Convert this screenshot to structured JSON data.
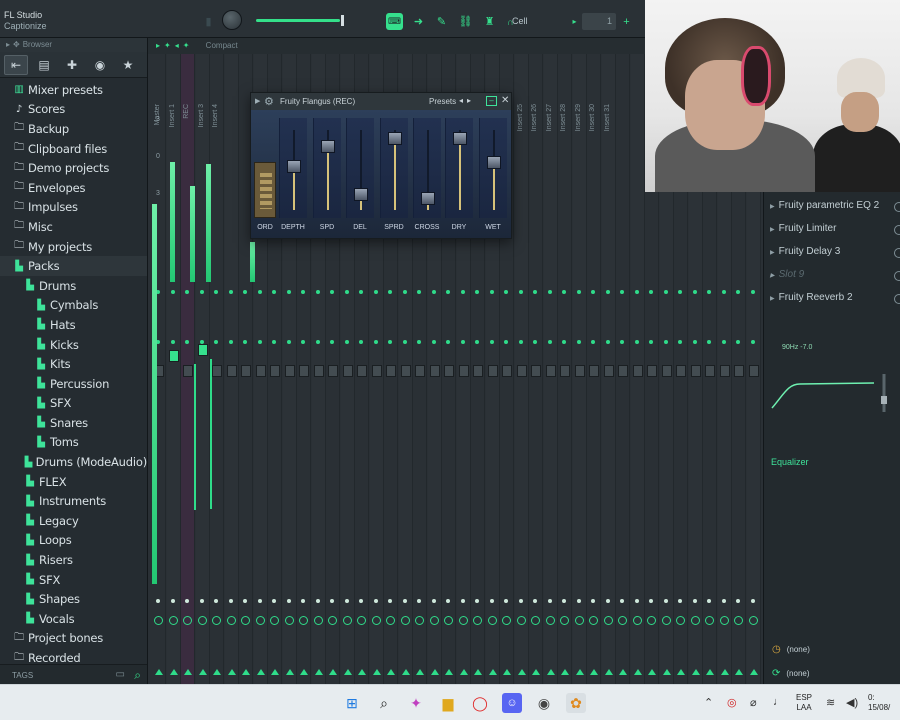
{
  "app": {
    "name": "FL Studio",
    "subtitle": "Captionize"
  },
  "toolbar": {
    "cell_label": "Cell",
    "pattern_value": "1"
  },
  "browser": {
    "header": "Browser",
    "footer_label": "TAGS",
    "items": [
      {
        "label": "Mixer presets",
        "level": 0,
        "icon": "mixer-preset-icon"
      },
      {
        "label": "Scores",
        "level": 0,
        "icon": "note-icon"
      },
      {
        "label": "Backup",
        "level": 0,
        "icon": "folder-icon"
      },
      {
        "label": "Clipboard files",
        "level": 0,
        "icon": "folder-icon"
      },
      {
        "label": "Demo projects",
        "level": 0,
        "icon": "folder-icon"
      },
      {
        "label": "Envelopes",
        "level": 0,
        "icon": "folder-icon"
      },
      {
        "label": "Impulses",
        "level": 0,
        "icon": "folder-icon"
      },
      {
        "label": "Misc",
        "level": 0,
        "icon": "folder-icon"
      },
      {
        "label": "My projects",
        "level": 0,
        "icon": "folder-icon"
      },
      {
        "label": "Packs",
        "level": 0,
        "icon": "pack-icon"
      },
      {
        "label": "Drums",
        "level": 1,
        "icon": "pack-icon"
      },
      {
        "label": "Cymbals",
        "level": 2,
        "icon": "pack-icon"
      },
      {
        "label": "Hats",
        "level": 2,
        "icon": "pack-icon"
      },
      {
        "label": "Kicks",
        "level": 2,
        "icon": "pack-icon"
      },
      {
        "label": "Kits",
        "level": 2,
        "icon": "pack-icon"
      },
      {
        "label": "Percussion",
        "level": 2,
        "icon": "pack-icon"
      },
      {
        "label": "SFX",
        "level": 2,
        "icon": "pack-icon"
      },
      {
        "label": "Snares",
        "level": 2,
        "icon": "pack-icon"
      },
      {
        "label": "Toms",
        "level": 2,
        "icon": "pack-icon"
      },
      {
        "label": "Drums (ModeAudio)",
        "level": 1,
        "icon": "pack-icon"
      },
      {
        "label": "FLEX",
        "level": 1,
        "icon": "pack-icon"
      },
      {
        "label": "Instruments",
        "level": 1,
        "icon": "pack-icon"
      },
      {
        "label": "Legacy",
        "level": 1,
        "icon": "pack-icon"
      },
      {
        "label": "Loops",
        "level": 1,
        "icon": "pack-icon"
      },
      {
        "label": "Risers",
        "level": 1,
        "icon": "pack-icon"
      },
      {
        "label": "SFX",
        "level": 1,
        "icon": "pack-icon"
      },
      {
        "label": "Shapes",
        "level": 1,
        "icon": "pack-icon"
      },
      {
        "label": "Vocals",
        "level": 1,
        "icon": "pack-icon"
      },
      {
        "label": "Project bones",
        "level": 0,
        "icon": "folder-icon"
      },
      {
        "label": "Recorded",
        "level": 0,
        "icon": "folder-icon"
      }
    ]
  },
  "mixer": {
    "view_mode": "Compact",
    "strips": [
      "Master",
      "Insert 1",
      "REC",
      "Insert 3",
      "Insert 4",
      "",
      "",
      "",
      "",
      "",
      "",
      "",
      "",
      "",
      "",
      "",
      "",
      "",
      "",
      "",
      "",
      "",
      "",
      "",
      "Insert 24",
      "Insert 25",
      "Insert 26",
      "Insert 27",
      "Insert 28",
      "Insert 29",
      "Insert 30",
      "Insert 31"
    ],
    "header_numbers": [
      "3",
      "0",
      "3"
    ]
  },
  "plugin": {
    "title": "Fruity Flangus (REC)",
    "presets_label": "Presets",
    "controls": [
      {
        "label": "ORD",
        "value": 0.5
      },
      {
        "label": "DEPTH",
        "value": 0.55
      },
      {
        "label": "SPD",
        "value": 0.8
      },
      {
        "label": "DEL",
        "value": 0.2
      },
      {
        "label": "SPRD",
        "value": 0.9
      },
      {
        "label": "CROSS",
        "value": 0.15
      },
      {
        "label": "DRY",
        "value": 0.9
      },
      {
        "label": "WET",
        "value": 0.6
      }
    ]
  },
  "effects": {
    "slots": [
      {
        "label": "Fruity parametric EQ 2",
        "enabled": true
      },
      {
        "label": "Fruity Limiter",
        "enabled": true
      },
      {
        "label": "Fruity Delay 3",
        "enabled": true
      },
      {
        "label": "Slot 9",
        "enabled": false
      },
      {
        "label": "Fruity Reeverb 2",
        "enabled": true
      }
    ],
    "eq_readout": "90Hz -7.0",
    "eq_label": "Equalizer",
    "route_in": "(none)",
    "route_out": "(none)"
  },
  "taskbar": {
    "lang_top": "ESP",
    "lang_bottom": "LAA",
    "time_top": "0:",
    "date": "15/08/"
  },
  "colors": {
    "accent": "#35e08d",
    "panel": "#2a3035",
    "browser_bg": "#252c31"
  }
}
